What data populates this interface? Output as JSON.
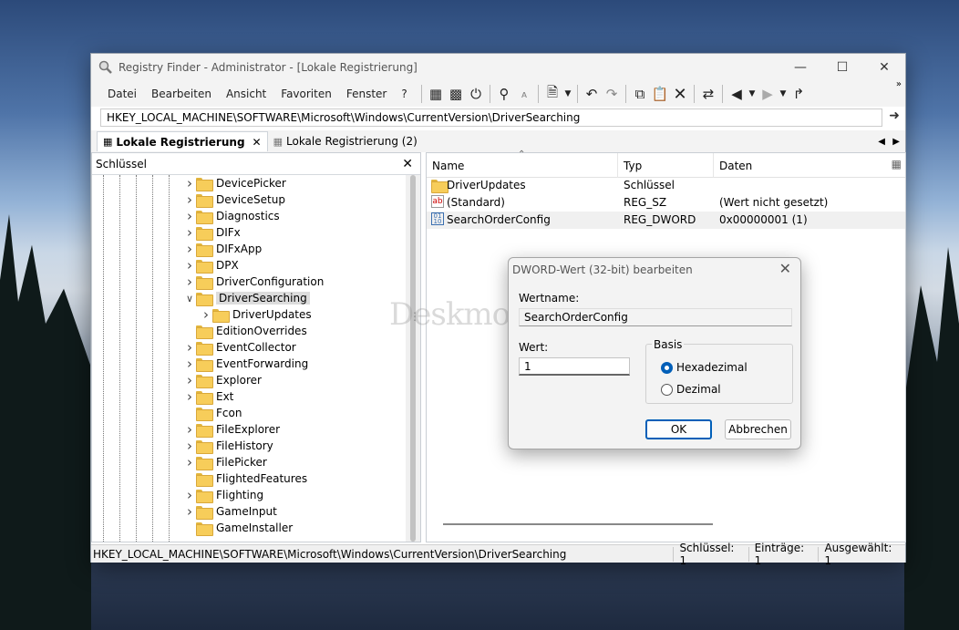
{
  "window": {
    "title": "Registry Finder - Administrator - [Lokale Registrierung]"
  },
  "menu": [
    "Datei",
    "Bearbeiten",
    "Ansicht",
    "Favoriten",
    "Fenster",
    "?"
  ],
  "address": "HKEY_LOCAL_MACHINE\\SOFTWARE\\Microsoft\\Windows\\CurrentVersion\\DriverSearching",
  "tabs": [
    {
      "label": "Lokale Registrierung"
    },
    {
      "label": "Lokale Registrierung (2)"
    }
  ],
  "left_panel": {
    "header": "Schlüssel"
  },
  "tree": [
    {
      "label": "DevicePicker"
    },
    {
      "label": "DeviceSetup"
    },
    {
      "label": "Diagnostics"
    },
    {
      "label": "DIFx"
    },
    {
      "label": "DIFxApp"
    },
    {
      "label": "DPX"
    },
    {
      "label": "DriverConfiguration"
    },
    {
      "label": "DriverSearching"
    },
    {
      "label": "DriverUpdates"
    },
    {
      "label": "EditionOverrides"
    },
    {
      "label": "EventCollector"
    },
    {
      "label": "EventForwarding"
    },
    {
      "label": "Explorer"
    },
    {
      "label": "Ext"
    },
    {
      "label": "Fcon"
    },
    {
      "label": "FileExplorer"
    },
    {
      "label": "FileHistory"
    },
    {
      "label": "FilePicker"
    },
    {
      "label": "FlightedFeatures"
    },
    {
      "label": "Flighting"
    },
    {
      "label": "GameInput"
    },
    {
      "label": "GameInstaller"
    }
  ],
  "columns": {
    "name": "Name",
    "type": "Typ",
    "data": "Daten"
  },
  "rows": [
    {
      "name": "DriverUpdates",
      "type": "Schlüssel",
      "data": ""
    },
    {
      "name": "(Standard)",
      "type": "REG_SZ",
      "data": "(Wert nicht gesetzt)"
    },
    {
      "name": "SearchOrderConfig",
      "type": "REG_DWORD",
      "data": "0x00000001 (1)"
    }
  ],
  "status": {
    "path": "HKEY_LOCAL_MACHINE\\SOFTWARE\\Microsoft\\Windows\\CurrentVersion\\DriverSearching",
    "keys": "Schlüssel: 1",
    "entries": "Einträge: 1",
    "selected": "Ausgewählt: 1"
  },
  "dialog": {
    "title": "DWORD-Wert (32-bit) bearbeiten",
    "name_label": "Wertname:",
    "name_value": "SearchOrderConfig",
    "value_label": "Wert:",
    "value": "1",
    "base_label": "Basis",
    "hex": "Hexadezimal",
    "dec": "Dezimal",
    "ok": "OK",
    "cancel": "Abbrechen"
  },
  "watermark": "Deskmodder.de"
}
